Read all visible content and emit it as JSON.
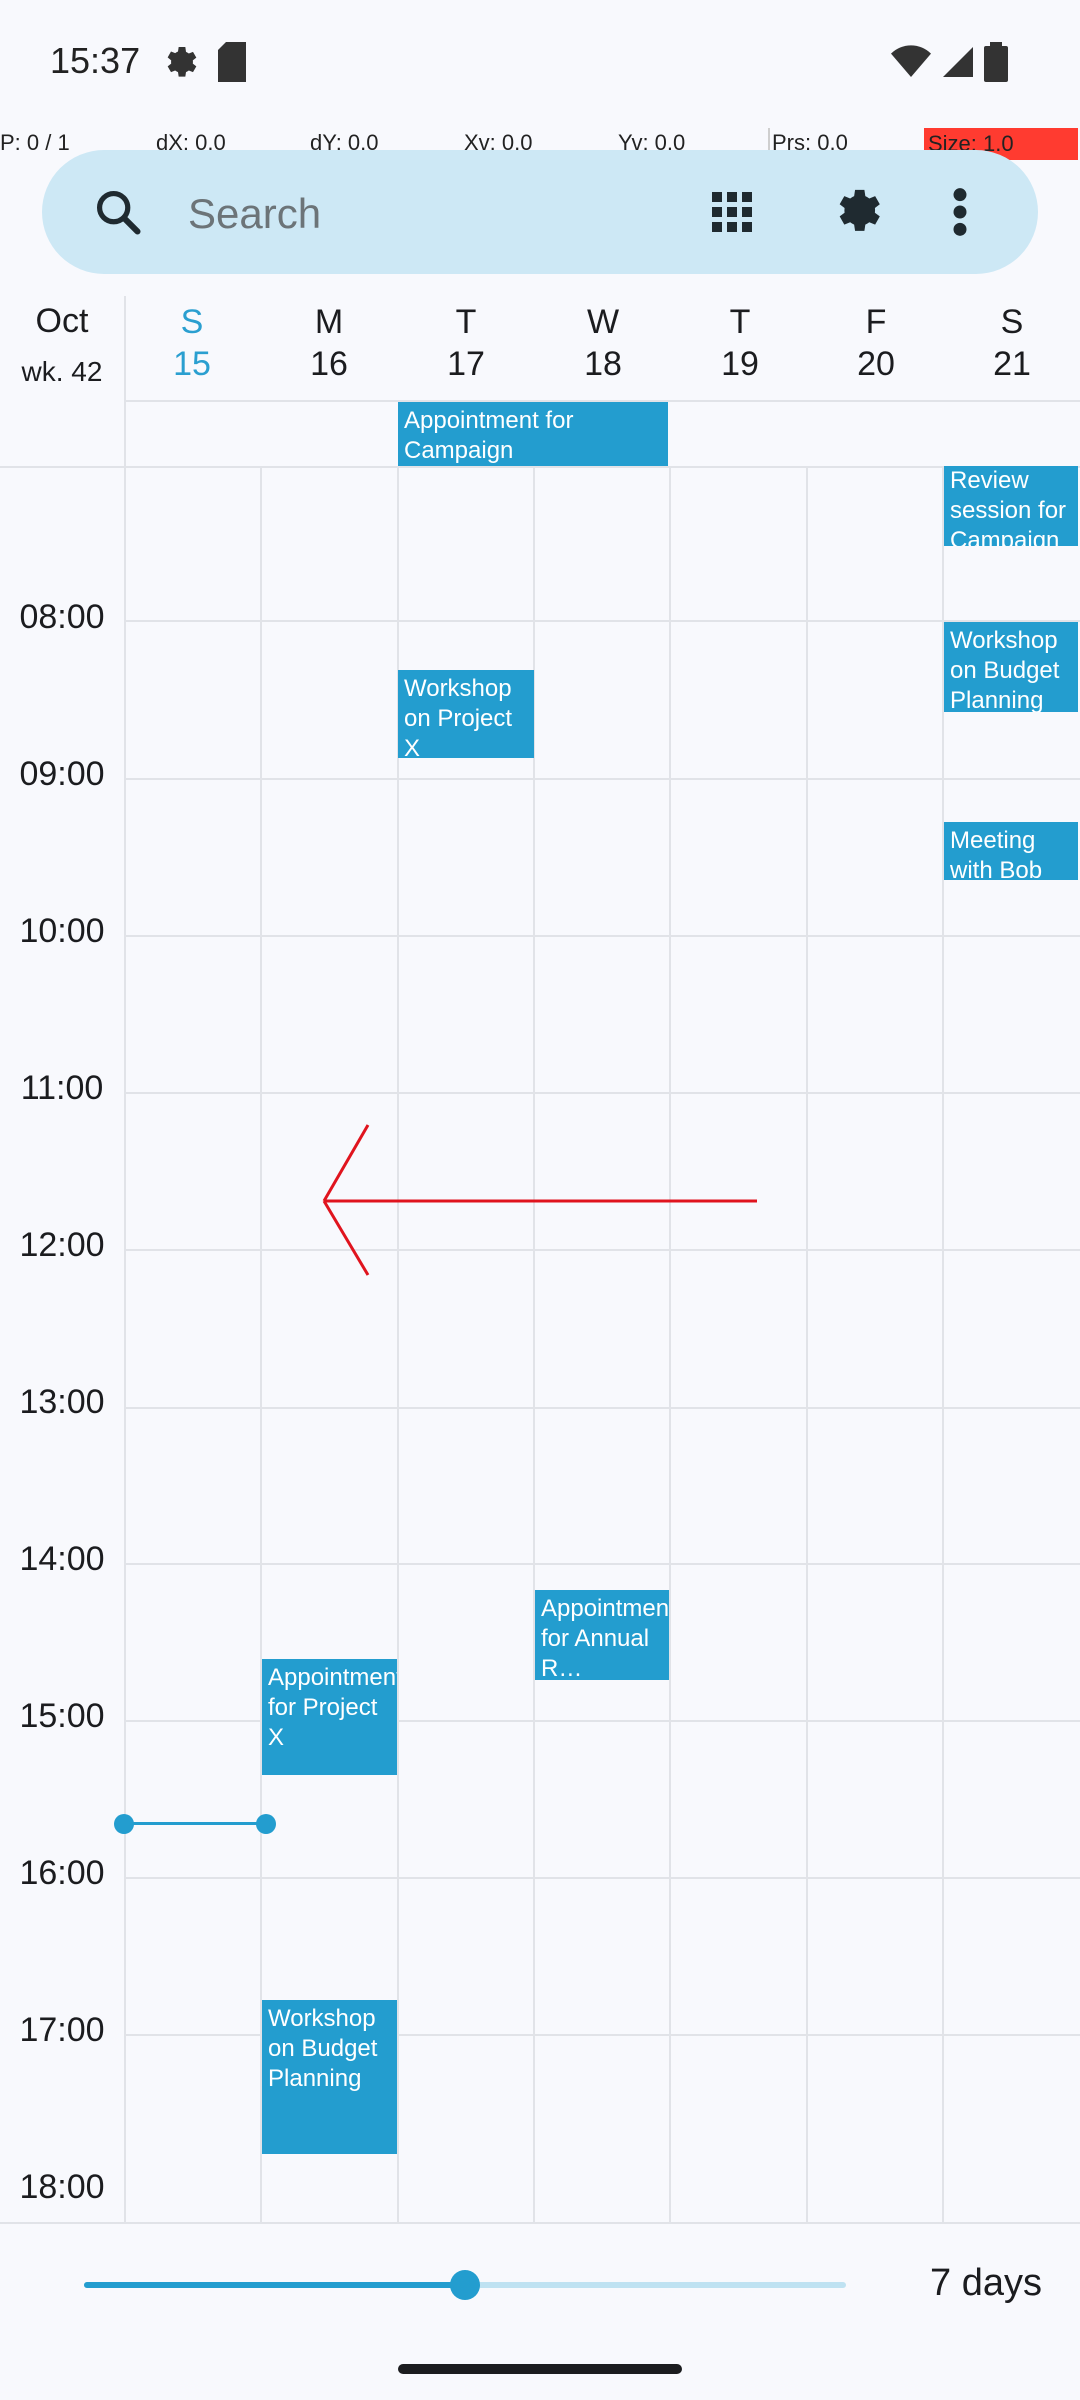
{
  "status": {
    "time": "15:37"
  },
  "debug": {
    "p": "P: 0 / 1",
    "dx": "dX: 0.0",
    "dy": "dY: 0.0",
    "xv": "Xv: 0.0",
    "yv": "Yv: 0.0",
    "prs": "Prs: 0.0",
    "size": "Size: 1.0"
  },
  "search": {
    "placeholder": "Search"
  },
  "header": {
    "month": "Oct",
    "week": "wk. 42",
    "days": [
      {
        "letter": "S",
        "num": "15"
      },
      {
        "letter": "M",
        "num": "16"
      },
      {
        "letter": "T",
        "num": "17"
      },
      {
        "letter": "W",
        "num": "18"
      },
      {
        "letter": "T",
        "num": "19"
      },
      {
        "letter": "F",
        "num": "20"
      },
      {
        "letter": "S",
        "num": "21"
      }
    ]
  },
  "times": [
    "08:00",
    "09:00",
    "10:00",
    "11:00",
    "12:00",
    "13:00",
    "14:00",
    "15:00",
    "16:00",
    "17:00",
    "18:00"
  ],
  "events": {
    "allday": "Appointment for Campaign",
    "ev1": "Review session for Campaign",
    "ev2": "Workshop on Budget Planning",
    "ev3": "Workshop on Project X",
    "ev4": "Meeting with Bob",
    "ev5": "Appointment for Annual R…",
    "ev6": "Appointment for Project X",
    "ev7": "Workshop on Budget Planning"
  },
  "footer": {
    "days_label": "7 days",
    "slider_fraction": 0.5
  },
  "colors": {
    "accent": "#239dcf",
    "today": "#2a9fd0",
    "swipe_arrow": "#e0141e"
  }
}
